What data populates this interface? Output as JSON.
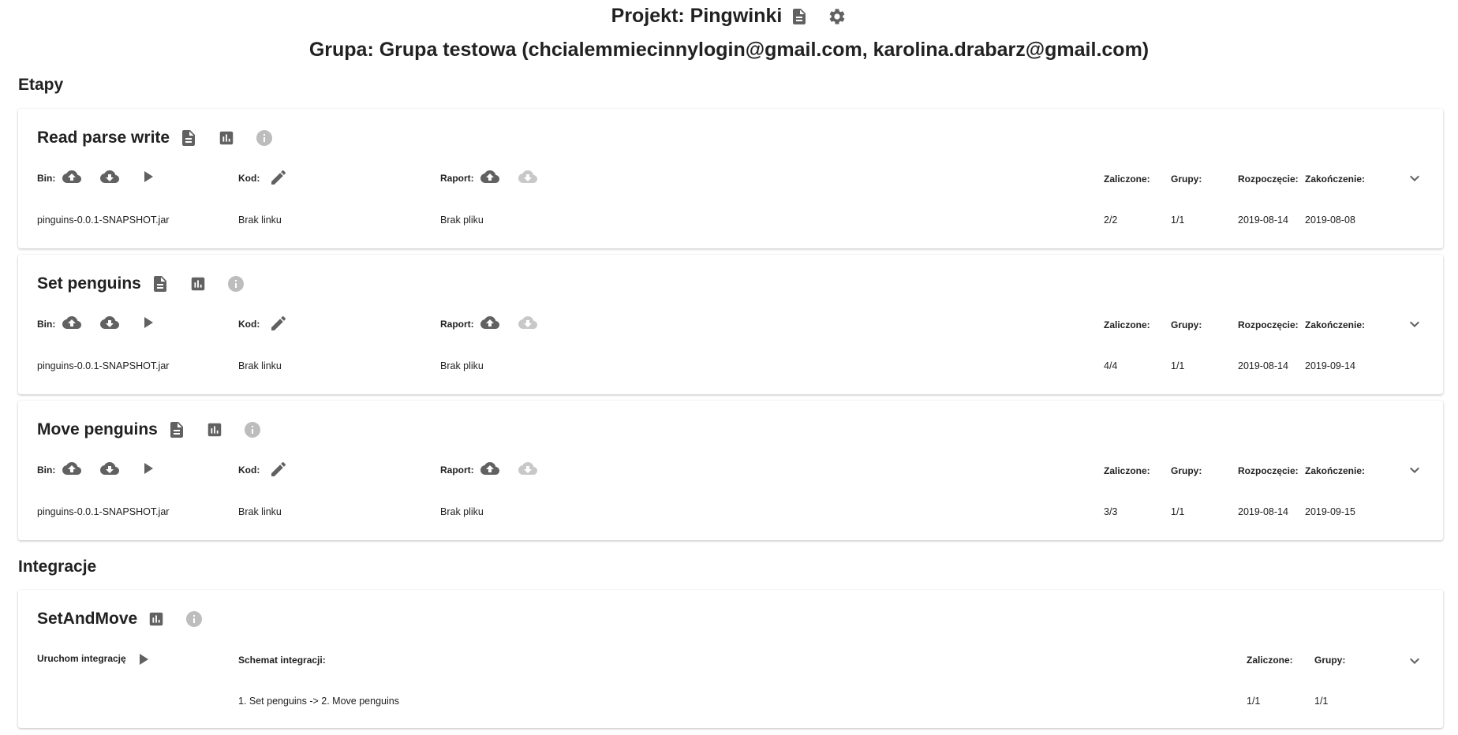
{
  "header": {
    "project_title": "Projekt: Pingwinki",
    "group_title": "Grupa: Grupa testowa (chcialemmiecinnylogin@gmail.com, karolina.drabarz@gmail.com)"
  },
  "stages_section": {
    "title": "Etapy"
  },
  "labels": {
    "bin": "Bin:",
    "code": "Kod:",
    "report": "Raport:",
    "passed": "Zaliczone:",
    "groups": "Grupy:",
    "start": "Rozpoczęcie:",
    "end": "Zakończenie:",
    "run_integration": "Uruchom integrację",
    "integration_schema": "Schemat integracji:"
  },
  "stages": [
    {
      "title": "Read parse write",
      "bin_file": "pinguins-0.0.1-SNAPSHOT.jar",
      "code_link": "Brak linku",
      "report_file": "Brak pliku",
      "passed": "2/2",
      "groups": "1/1",
      "start": "2019-08-14",
      "end": "2019-08-08"
    },
    {
      "title": "Set penguins",
      "bin_file": "pinguins-0.0.1-SNAPSHOT.jar",
      "code_link": "Brak linku",
      "report_file": "Brak pliku",
      "passed": "4/4",
      "groups": "1/1",
      "start": "2019-08-14",
      "end": "2019-09-14"
    },
    {
      "title": "Move penguins",
      "bin_file": "pinguins-0.0.1-SNAPSHOT.jar",
      "code_link": "Brak linku",
      "report_file": "Brak pliku",
      "passed": "3/3",
      "groups": "1/1",
      "start": "2019-08-14",
      "end": "2019-09-15"
    }
  ],
  "integrations_section": {
    "title": "Integracje"
  },
  "integrations": [
    {
      "title": "SetAndMove",
      "schema": "1. Set penguins -> 2. Move penguins",
      "passed": "1/1",
      "groups": "1/1"
    }
  ],
  "colors": {
    "icon_dark": "#616161",
    "icon_light": "#bdbdbd",
    "icon_disabled": "#c8c8c8"
  }
}
